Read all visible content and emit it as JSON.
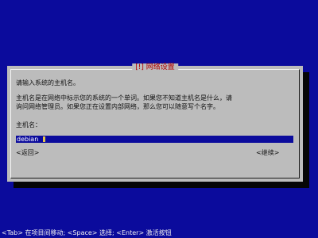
{
  "window": {
    "title": "[!] 网络设置"
  },
  "dialog": {
    "line1": "请输入系统的主机名。",
    "line2": "主机名是在网络中标示您的系统的一个单词。如果您不知道主机名是什么，请",
    "line3": "询问网络管理员。如果您正在设置内部网络，那么您可以随意写个名字。",
    "field_label": "主机名：",
    "field_value": "debian"
  },
  "buttons": {
    "back": "<返回>",
    "continue": "<继续>"
  },
  "status": {
    "text": "<Tab> 在项目间移动; <Space> 选择; <Enter> 激活按钮"
  },
  "colors": {
    "background": "#0b0b9c",
    "dialog": "#bcbcbc",
    "title": "#b00000",
    "cursor": "#e3c54c"
  }
}
